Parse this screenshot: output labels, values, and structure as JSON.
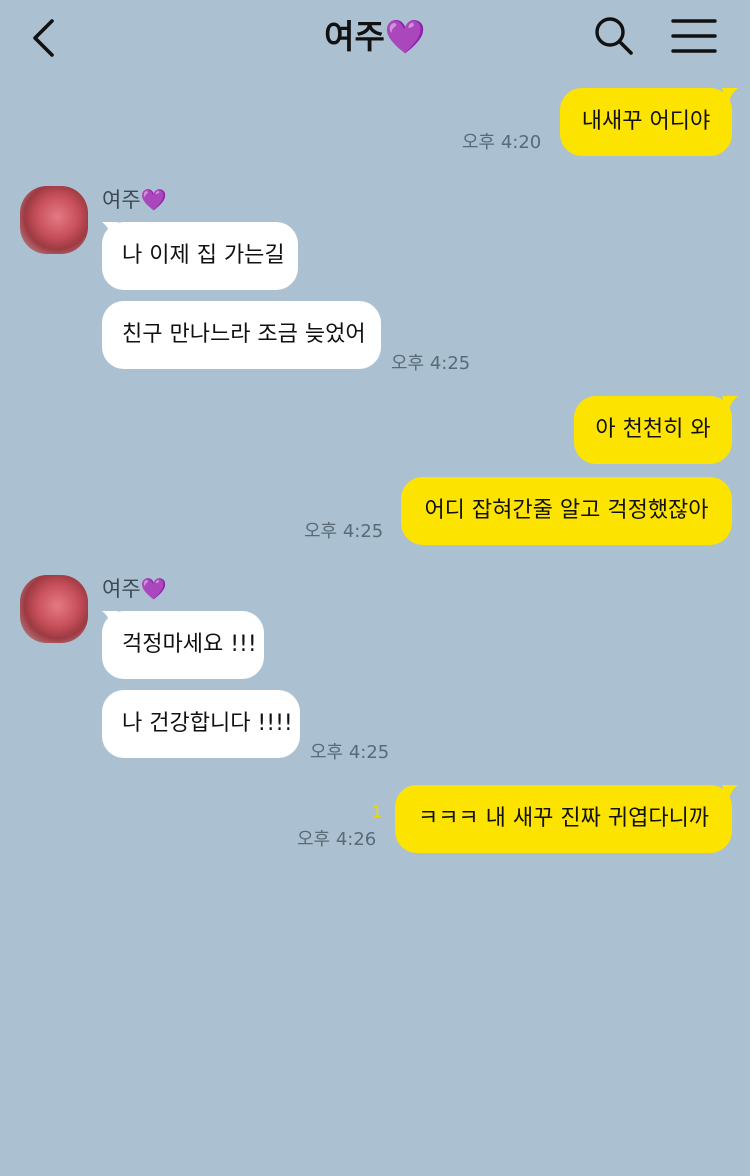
{
  "header": {
    "title": "여주💜"
  },
  "chat": {
    "contact_name": "여주💜",
    "messages": [
      {
        "text": "내새꾸 어디야",
        "time": "오후 4:20"
      },
      {
        "text": "나 이제 집 가는길"
      },
      {
        "text": "친구 만나느라 조금 늦었어",
        "time": "오후 4:25"
      },
      {
        "text": "아 천천히 와"
      },
      {
        "text": "어디 잡혀간줄 알고 걱정했잖아",
        "time": "오후 4:25"
      },
      {
        "text": "걱정마세요 !!!"
      },
      {
        "text": "나 건강합니다 !!!!",
        "time": "오후 4:25"
      },
      {
        "text": "ㅋㅋㅋ 내 새꾸 진짜 귀엽다니까",
        "time": "오후 4:26",
        "unread": "1"
      }
    ]
  },
  "colors": {
    "background": "#abc1d1",
    "outgoing_bubble": "#fde400",
    "incoming_bubble": "#ffffff"
  },
  "icons": {
    "back": "chevron-left-icon",
    "search": "search-icon",
    "menu": "menu-icon"
  }
}
